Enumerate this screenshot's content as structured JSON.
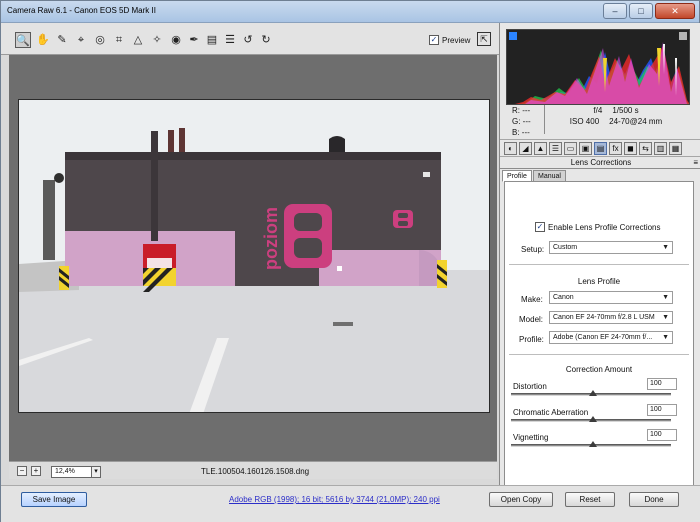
{
  "window": {
    "title": "Camera Raw 6.1  -  Canon EOS 5D Mark II",
    "controls": [
      "minimize",
      "maximize",
      "close"
    ]
  },
  "toolbar": {
    "tools": [
      "zoom-icon",
      "hand-icon",
      "white-balance-icon",
      "color-sampler-icon",
      "target-adjust-icon",
      "crop-icon",
      "straighten-icon",
      "spot-removal-icon",
      "red-eye-icon",
      "adjustment-brush-icon",
      "graduated-filter-icon",
      "preferences-icon",
      "rotate-left-icon",
      "rotate-right-icon"
    ],
    "preview_label": "Preview",
    "preview_checked": true
  },
  "histogram": {
    "colors": {
      "red": "#ff2b2b",
      "green": "#22d34e",
      "blue": "#2257ff",
      "magenta": "#e54cff",
      "yellow": "#f0d42d",
      "white": "#ffffff"
    }
  },
  "readout": {
    "r": "R:  ---",
    "g": "G:  ---",
    "b": "B:  ---",
    "aperture": "f/4",
    "shutter": "1/500 s",
    "iso": "ISO 400",
    "lens": "24-70@24 mm"
  },
  "panel": {
    "title": "Lens Corrections",
    "tabs": [
      "Profile",
      "Manual"
    ],
    "enable_label": "Enable Lens Profile Corrections",
    "enable_checked": true,
    "setup_label": "Setup:",
    "setup_value": "Custom",
    "lens_profile_heading": "Lens Profile",
    "make_label": "Make:",
    "make_value": "Canon",
    "model_label": "Model:",
    "model_value": "Canon EF 24-70mm f/2.8 L USM",
    "profile_label": "Profile:",
    "profile_value": "Adobe (Canon EF 24-70mm f/...",
    "correction_heading": "Correction Amount",
    "distortion_label": "Distortion",
    "distortion_value": "100",
    "chromatic_label": "Chromatic Aberration",
    "chromatic_value": "100",
    "vignetting_label": "Vignetting",
    "vignetting_value": "100"
  },
  "status": {
    "zoom_value": "12,4%",
    "filename": "TLE.100504.160126.1508.dng"
  },
  "photo": {
    "wall_text": "poziom",
    "accent_pink": "#d1a3c8",
    "magenta": "#cc3f7f",
    "building_gray": "#4e474b",
    "sky": "#e9ecef",
    "floor": "#d9dadd"
  },
  "bottom": {
    "save_image": "Save Image",
    "workflow_link": "Adobe RGB (1998); 16 bit; 5616 by 3744 (21,0MP); 240 ppi",
    "open_copy": "Open Copy",
    "reset": "Reset",
    "done": "Done"
  }
}
